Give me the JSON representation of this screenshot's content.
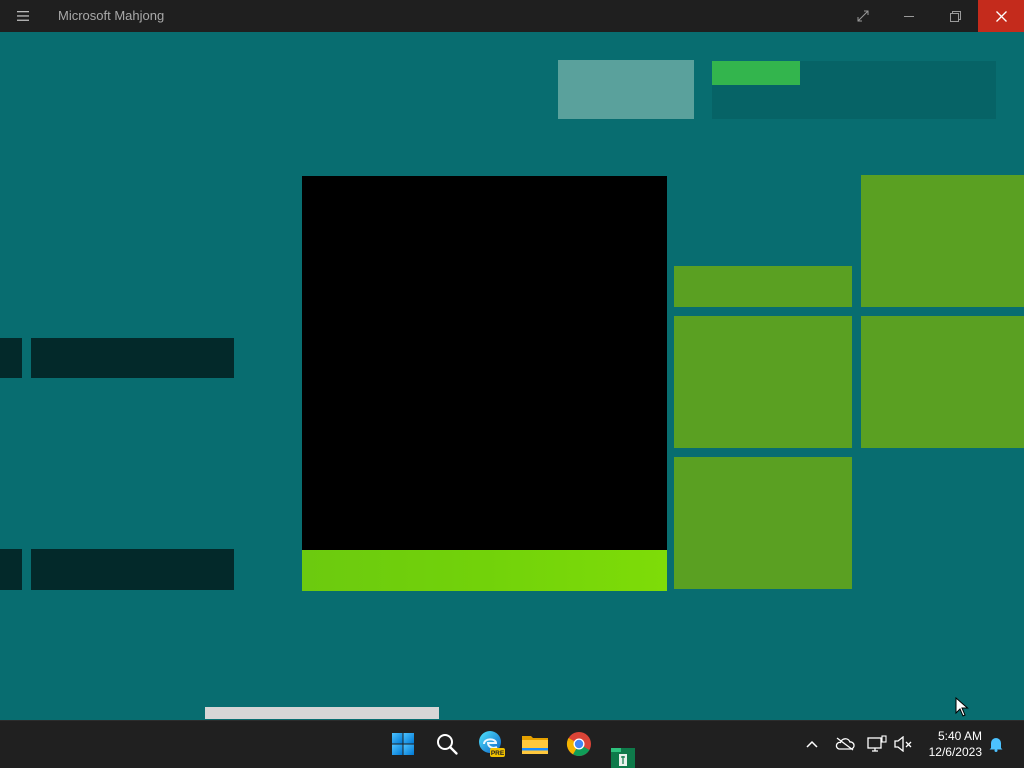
{
  "window": {
    "title": "Microsoft Mahjong",
    "controls": [
      "fullscreen-icon",
      "minimize-icon",
      "restore-icon",
      "close-icon"
    ],
    "titlebar_color": "#1f1f1f",
    "close_color": "#c42b1c"
  },
  "content": {
    "background": "#086d70",
    "progress_fraction": 0.31,
    "accent_green": "#33b54d",
    "tile_green": "#5aa022"
  },
  "taskbar": {
    "pinned": [
      "windows-start-icon",
      "search-icon",
      "edge-beta-icon",
      "file-explorer-icon",
      "chrome-icon",
      "mahjong-app-icon"
    ],
    "tray_icons": [
      "chevron-up-icon",
      "onedrive-offline-icon",
      "network-icon",
      "volume-muted-icon",
      "notification-bell-icon"
    ],
    "time": "5:40 AM",
    "date": "12/6/2023",
    "edge_badge": "PRE"
  }
}
